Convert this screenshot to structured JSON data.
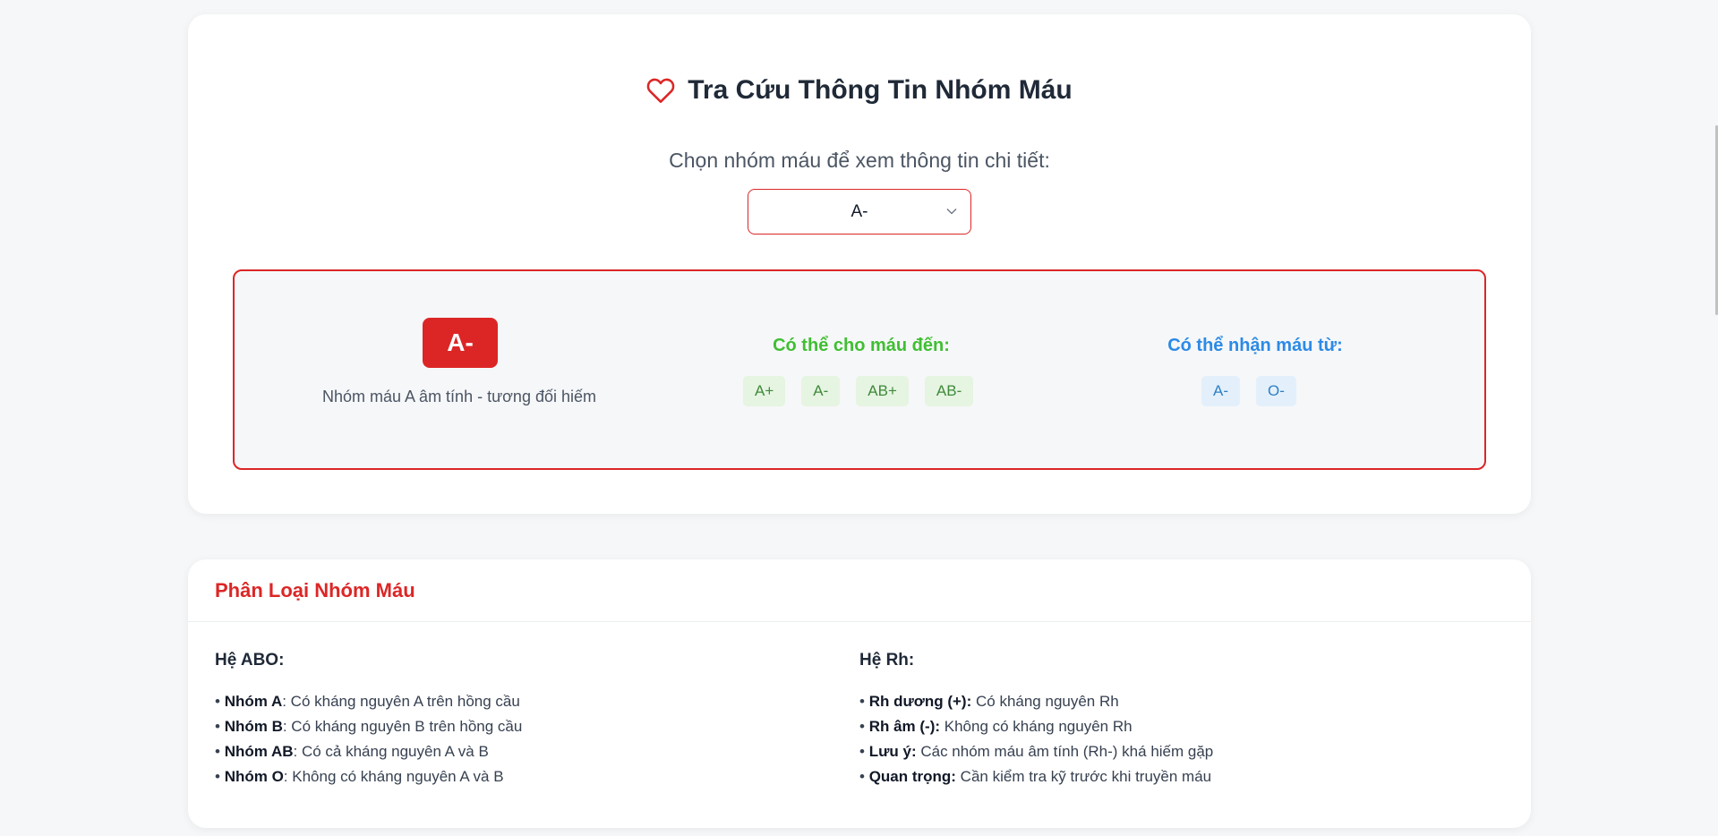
{
  "lookup": {
    "title": "Tra Cứu Thông Tin Nhóm Máu",
    "subtitle": "Chọn nhóm máu để xem thông tin chi tiết:",
    "select_value": "A-",
    "result": {
      "badge": "A-",
      "description": "Nhóm máu A âm tính - tương đối hiếm",
      "give_heading": "Có thể cho máu đến:",
      "give_to": [
        "A+",
        "A-",
        "AB+",
        "AB-"
      ],
      "receive_heading": "Có thể nhận máu từ:",
      "receive_from": [
        "A-",
        "O-"
      ]
    }
  },
  "classification": {
    "title": "Phân Loại Nhóm Máu",
    "abo": {
      "heading": "Hệ ABO:",
      "items": [
        {
          "term": "Nhóm A",
          "text": ": Có kháng nguyên A trên hồng cầu"
        },
        {
          "term": "Nhóm B",
          "text": ": Có kháng nguyên B trên hồng cầu"
        },
        {
          "term": "Nhóm AB",
          "text": ": Có cả kháng nguyên A và B"
        },
        {
          "term": "Nhóm O",
          "text": ": Không có kháng nguyên A và B"
        }
      ]
    },
    "rh": {
      "heading": "Hệ Rh:",
      "items": [
        {
          "term": "Rh dương (+):",
          "text": " Có kháng nguyên Rh"
        },
        {
          "term": "Rh âm (-):",
          "text": " Không có kháng nguyên Rh"
        },
        {
          "term": "Lưu ý:",
          "text": " Các nhóm máu âm tính (Rh-) khá hiếm gặp"
        },
        {
          "term": "Quan trọng:",
          "text": " Cần kiểm tra kỹ trước khi truyền máu"
        }
      ]
    }
  },
  "colors": {
    "accent": "#dc2626",
    "give": "#3fbf32",
    "receive": "#2b8ae5"
  },
  "icons": {
    "title": "heart-icon",
    "select": "chevron-down-icon"
  }
}
